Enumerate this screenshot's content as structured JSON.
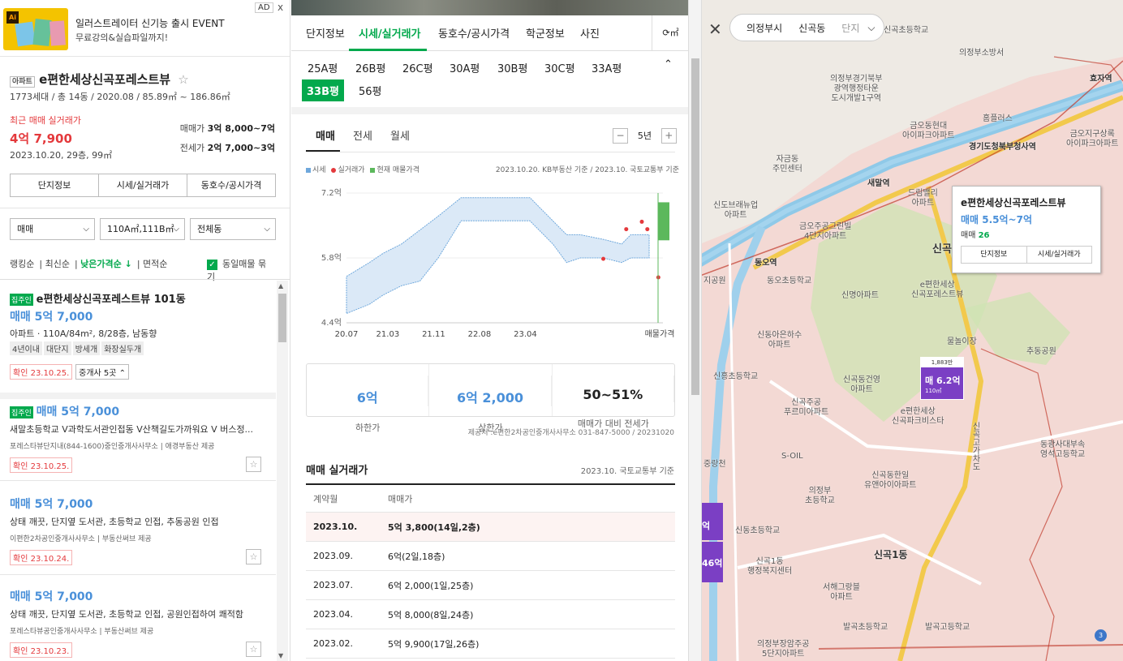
{
  "ad": {
    "title": "일러스트레이터 신기능 출시 EVENT",
    "subtitle": "무료강의&실습파일까지!",
    "badge": "AD",
    "close": "x"
  },
  "complex": {
    "type_tag": "아파트",
    "name": "e편한세상신곡포레스트뷰",
    "info": "1773세대 / 총 14동 / 2020.08 / 85.89㎡ ~ 186.86㎡",
    "recent_label": "최근 매매 실거래가",
    "recent_price": "4억 7,900",
    "recent_detail": "2023.10.20, 29층, 99㎡",
    "sale_label": "매매가",
    "sale_value": "3억 8,000~7억",
    "jeonse_label": "전세가",
    "jeonse_value": "2억 7,000~3억",
    "buttons": [
      "단지정보",
      "시세/실거래가",
      "동호수/공시가격"
    ]
  },
  "filters": {
    "type": "매매",
    "area": "110A㎡,111B㎡",
    "dong": "전체동"
  },
  "sort": {
    "options": [
      "랭킹순",
      "최신순",
      "낮은가격순 ↓",
      "면적순"
    ],
    "active_index": 2,
    "group_label": "동일매물 묶기"
  },
  "listings": [
    {
      "owner": "집주인",
      "title": "e편한세상신곡포레스트뷰 101동",
      "price": "매매 5억 7,000",
      "desc": "아파트 · 110A/84m², 8/28층, 남동향",
      "chips": [
        "4년이내",
        "대단지",
        "방세개",
        "화장실두개"
      ],
      "confirm": "확인 23.10.25.",
      "broker_count": "중개사 5곳"
    },
    {
      "owner": "집주인",
      "price": "매매 5억 7,000",
      "desc": "새말초등학교 V과학도서관인접동 V산책길도가까워요 V 버스정...",
      "broker": "포레스타뷰단지내(844-1600)중인중개사사무소",
      "provider": "애경부동산 제공",
      "confirm": "확인 23.10.25."
    },
    {
      "price": "매매 5억 7,000",
      "desc": "상태 깨끗, 단지옆 도서관, 초등학교 인접, 추동공원 인접",
      "broker": "이편한2차공인중개사사무소",
      "provider": "부동산써브 제공",
      "confirm": "확인 23.10.24."
    },
    {
      "price": "매매 5억 7,000",
      "desc": "상태 깨끗, 단지옆 도서관, 초등학교 인접, 공원인접하여 쾌적함",
      "broker": "포레스타뷰공인중개사사무소",
      "provider": "부동산써브 제공",
      "confirm": "확인 23.10.23."
    }
  ],
  "tabs": {
    "items": [
      "단지정보",
      "시세/실거래가",
      "동호수/공시가격",
      "학군정보",
      "사진"
    ],
    "active_index": 1,
    "refresh": "⟳㎡"
  },
  "pyeong_types": {
    "items": [
      "25A평",
      "26B평",
      "26C평",
      "30A평",
      "30B평",
      "30C평",
      "33A평",
      "33B평",
      "56평"
    ],
    "active": "33B평"
  },
  "price_tabs": {
    "items": [
      "매매",
      "전세",
      "월세"
    ],
    "active_index": 0,
    "period": "5년"
  },
  "legend": {
    "items": [
      "시세",
      "실거래가",
      "현재 매물가격"
    ],
    "source": "2023.10.20. KB부동산 기준 / 2023.10. 국토교통부 기준"
  },
  "chart_data": {
    "type": "line",
    "x_ticks": [
      "20.07",
      "21.03",
      "21.11",
      "22.08",
      "23.04",
      "매물가격"
    ],
    "y_ticks": [
      "4.4억",
      "5.8억",
      "7.2억"
    ],
    "ylim": [
      4.4,
      7.2
    ],
    "series": [
      {
        "name": "시세",
        "type": "band",
        "x": [
          2020.5,
          2020.75,
          2020.9,
          2021.1,
          2021.3,
          2021.5,
          2021.75,
          2021.9,
          2022.1,
          2022.3,
          2022.5,
          2022.75,
          2022.9,
          2023.05,
          2023.3,
          2023.5,
          2023.6,
          2023.8
        ],
        "upper": [
          5.4,
          5.7,
          5.9,
          6.1,
          6.4,
          6.7,
          7.1,
          7.1,
          7.1,
          7.1,
          7.1,
          6.6,
          6.3,
          6.3,
          6.2,
          6.1,
          6.3,
          6.3
        ],
        "lower": [
          4.6,
          4.8,
          5.0,
          5.2,
          5.3,
          5.8,
          6.6,
          6.6,
          6.6,
          6.6,
          6.6,
          6.1,
          5.7,
          5.8,
          5.8,
          5.7,
          5.8,
          5.8
        ]
      },
      {
        "name": "실거래가",
        "type": "scatter",
        "x": [
          2023.3,
          2023.55,
          2023.72,
          2023.78,
          2023.9
        ],
        "y": [
          5.78,
          6.42,
          6.58,
          6.42,
          5.38
        ]
      },
      {
        "name": "현재 매물가격",
        "type": "bar",
        "x": [
          2023.95
        ],
        "low": 6.18,
        "high": 7.0
      }
    ]
  },
  "stats": [
    {
      "value": "6억",
      "label": "하한가"
    },
    {
      "value": "6억 2,000",
      "label": "상한가"
    },
    {
      "value": "50~51%",
      "label": "매매가 대비 전세가"
    }
  ],
  "provider_note": "제공처 :e편한2차공인중개사사무소 031-847-5000 / 20231020",
  "deals": {
    "title": "매매 실거래가",
    "source": "2023.10. 국토교통부 기준",
    "headers": [
      "계약월",
      "매매가"
    ],
    "rows": [
      {
        "month": "2023.10.",
        "price": "5억 3,800(14일,2층)"
      },
      {
        "month": "2023.09.",
        "price": "6억(2일,18층)"
      },
      {
        "month": "2023.07.",
        "price": "6억 2,000(1일,25층)"
      },
      {
        "month": "2023.04.",
        "price": "5억 8,000(8일,24층)"
      },
      {
        "month": "2023.02.",
        "price": "5억 9,900(17일,26층)"
      }
    ]
  },
  "map": {
    "breadcrumb": [
      "의정부시",
      "신곡동",
      "단지"
    ],
    "labels": [
      "신곡초등학교",
      "의정부소방서",
      "의정부경기북부\n광역행정타운\n도시개발1구역",
      "홈플러스",
      "효자역",
      "금오동현대\n아이파크아파트",
      "금오지구상록\n아이파크아파트",
      "경기도청북부청사역",
      "자금동\n주민센터",
      "새말역",
      "드림밸리\n아파트",
      "신도브래뉴업\n아파트",
      "금오주공그린빌\n4단지아파트",
      "동오역",
      "동오초등학교",
      "신곡",
      "e편한세상\n신곡포레스트뷰",
      "신명아파트",
      "물놀이장",
      "추동공원",
      "신동아은하수\n아파트",
      "신흥초등학교",
      "신곡동건영\n아파트",
      "신곡주공\n푸르미아파트",
      "e편한세상\n신곡파크비스타",
      "S-OIL",
      "동광사대부속\n영석고등학교",
      "의정부\n초등학교",
      "신곡동한일\n유앤아이아파트",
      "신동초등학교",
      "신곡1동\n행정복지센터",
      "신곡1동",
      "서해그랑블\n아파트",
      "발곡초등학교",
      "발곡고등학교",
      "의정부장암주공\n5단지아파트",
      "지공원",
      "중랑천",
      "신곡고가차도"
    ],
    "popup": {
      "title": "e편한세상신곡포레스트뷰",
      "price": "매매 5.5억~7억",
      "count_label": "매매",
      "count": "26",
      "buttons": [
        "단지정보",
        "시세/실거래가"
      ]
    },
    "marker": {
      "top": "1,883만",
      "price": "매 6.2억",
      "area": "110㎡"
    },
    "edge_markers": [
      "억",
      "46억"
    ],
    "badge": "3"
  }
}
